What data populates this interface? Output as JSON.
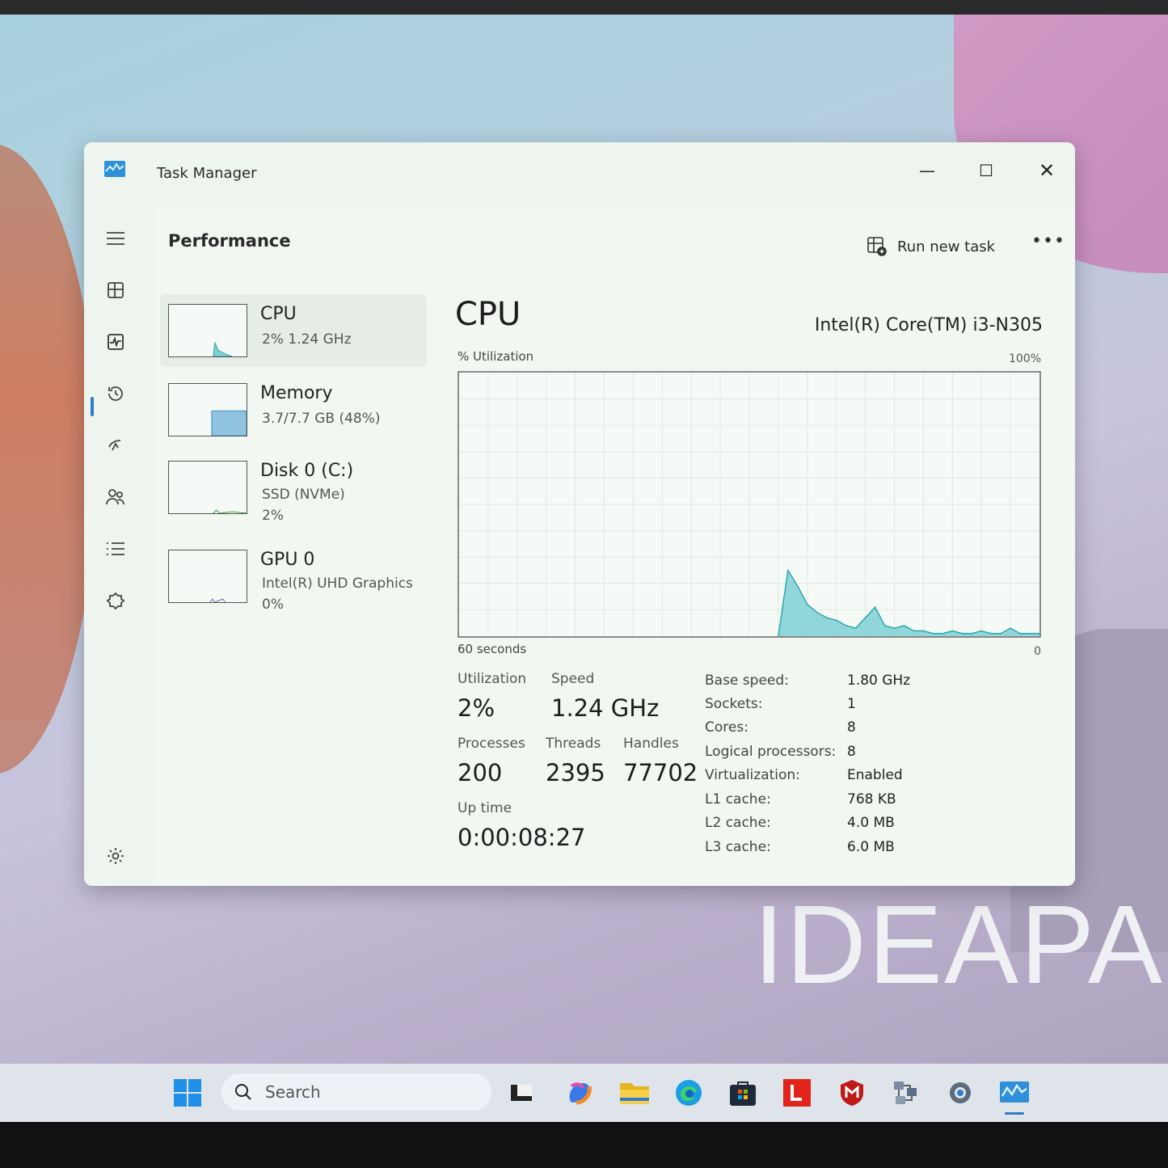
{
  "window": {
    "title": "Task Manager",
    "minimize": "—",
    "maximize": "☐",
    "close": "✕"
  },
  "header": {
    "page_title": "Performance",
    "run_new_task": "Run new task",
    "more": "•••"
  },
  "devices": [
    {
      "name": "CPU",
      "sub1": "2%  1.24 GHz",
      "sub2": ""
    },
    {
      "name": "Memory",
      "sub1": "3.7/7.7 GB (48%)",
      "sub2": ""
    },
    {
      "name": "Disk 0 (C:)",
      "sub1": "SSD (NVMe)",
      "sub2": "2%"
    },
    {
      "name": "GPU 0",
      "sub1": "Intel(R) UHD Graphics",
      "sub2": "0%"
    }
  ],
  "detail": {
    "heading": "CPU",
    "model": "Intel(R) Core(TM) i3-N305",
    "util_axis_label": "% Utilization",
    "max_label": "100%",
    "time_label": "60 seconds",
    "zero_label": "0",
    "stats": {
      "utilization_label": "Utilization",
      "utilization": "2%",
      "speed_label": "Speed",
      "speed": "1.24 GHz",
      "processes_label": "Processes",
      "processes": "200",
      "threads_label": "Threads",
      "threads": "2395",
      "handles_label": "Handles",
      "handles": "77702",
      "uptime_label": "Up time",
      "uptime": "0:00:08:27"
    },
    "specs": [
      {
        "k": "Base speed:",
        "v": "1.80 GHz"
      },
      {
        "k": "Sockets:",
        "v": "1"
      },
      {
        "k": "Cores:",
        "v": "8"
      },
      {
        "k": "Logical processors:",
        "v": "8"
      },
      {
        "k": "Virtualization:",
        "v": "Enabled"
      },
      {
        "k": "L1 cache:",
        "v": "768 KB"
      },
      {
        "k": "L2 cache:",
        "v": "4.0 MB"
      },
      {
        "k": "L3 cache:",
        "v": "6.0 MB"
      }
    ]
  },
  "chart_data": {
    "type": "area",
    "ylim": [
      0,
      100
    ],
    "x": [
      60,
      59,
      58,
      57,
      56,
      55,
      54,
      53,
      52,
      51,
      50,
      49,
      48,
      47,
      46,
      45,
      44,
      43,
      42,
      41,
      40,
      39,
      38,
      37,
      36,
      35,
      34,
      33,
      32,
      31,
      30,
      29,
      28,
      27,
      26,
      25,
      24,
      23,
      22,
      21,
      20,
      19,
      18,
      17,
      16,
      15,
      14,
      13,
      12,
      11,
      10,
      9,
      8,
      7,
      6,
      5,
      4,
      3,
      2,
      1,
      0
    ],
    "values": [
      0,
      0,
      0,
      0,
      0,
      0,
      0,
      0,
      0,
      0,
      0,
      0,
      0,
      0,
      0,
      0,
      0,
      0,
      0,
      0,
      0,
      0,
      0,
      0,
      0,
      0,
      0,
      0,
      0,
      0,
      0,
      0,
      0,
      0,
      25,
      19,
      12,
      9,
      7,
      6,
      4,
      3,
      7,
      11,
      4,
      3,
      4,
      2,
      2,
      1,
      1,
      2,
      1,
      1,
      2,
      1,
      1,
      3,
      1,
      1,
      1
    ],
    "fill": "#7fd0d3",
    "stroke": "#2ca6ad"
  },
  "memory_thumb": {
    "used_fraction": 0.48
  },
  "desktop": {
    "brand": "IDEAPA"
  },
  "taskbar": {
    "search_placeholder": "Search",
    "icons": [
      "start-icon",
      "search-icon",
      "task-view-icon",
      "copilot-icon",
      "file-explorer-icon",
      "edge-icon",
      "store-icon",
      "l-app-icon",
      "mcafee-icon",
      "network-app-icon",
      "settings-icon",
      "task-manager-icon"
    ]
  },
  "colors": {
    "accent": "#2f7cc9",
    "chart_line": "#2ca6ad",
    "chart_fill": "#7fd0d3",
    "memory": "#8fc3e0"
  }
}
